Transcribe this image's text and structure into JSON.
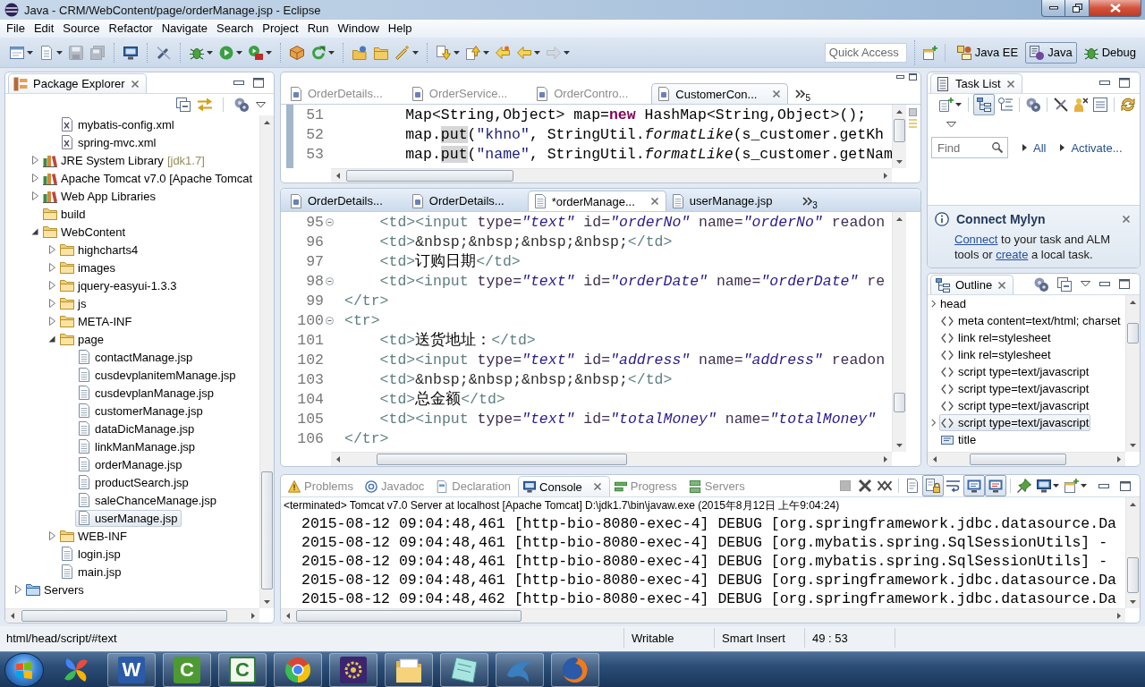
{
  "window": {
    "title": "Java - CRM/WebContent/page/orderManage.jsp - Eclipse"
  },
  "menu": [
    "File",
    "Edit",
    "Source",
    "Refactor",
    "Navigate",
    "Search",
    "Project",
    "Run",
    "Window",
    "Help"
  ],
  "toolbar": {
    "groups": [
      [
        {
          "kind": "new-window",
          "dropdown": true,
          "disabled": false
        },
        {
          "kind": "new",
          "dropdown": true,
          "disabled": false
        },
        {
          "kind": "save",
          "dropdown": false,
          "disabled": true
        },
        {
          "kind": "save-all",
          "dropdown": false,
          "disabled": true
        }
      ],
      [
        {
          "kind": "monitor",
          "dropdown": false,
          "disabled": false
        }
      ],
      [
        {
          "kind": "pen",
          "dropdown": false,
          "disabled": false
        }
      ],
      [
        {
          "kind": "bug",
          "dropdown": true,
          "disabled": false
        },
        {
          "kind": "run",
          "dropdown": true,
          "disabled": false
        },
        {
          "kind": "external",
          "dropdown": true,
          "disabled": false
        }
      ],
      [
        {
          "kind": "package",
          "dropdown": false,
          "disabled": false
        },
        {
          "kind": "refresh",
          "dropdown": true,
          "disabled": false
        }
      ],
      [
        {
          "kind": "open-type",
          "dropdown": false,
          "disabled": false
        },
        {
          "kind": "folder",
          "dropdown": false,
          "disabled": false
        },
        {
          "kind": "wand",
          "dropdown": true,
          "disabled": false
        }
      ],
      [
        {
          "kind": "arrow-down",
          "dropdown": true,
          "disabled": false
        },
        {
          "kind": "arrow-up",
          "dropdown": true,
          "disabled": false
        },
        {
          "kind": "edit-back",
          "dropdown": false,
          "disabled": false
        },
        {
          "kind": "back",
          "dropdown": true,
          "disabled": false
        },
        {
          "kind": "forward",
          "dropdown": true,
          "disabled": true
        }
      ]
    ],
    "quick_access": {
      "placeholder": "Quick Access"
    },
    "perspectives": [
      {
        "label": "Java EE",
        "kind": "java-ee",
        "selected": false
      },
      {
        "label": "Java",
        "kind": "java",
        "selected": true
      },
      {
        "label": "Debug",
        "kind": "debug",
        "selected": false
      }
    ]
  },
  "package_explorer": {
    "title": "Package Explorer",
    "tree": [
      {
        "children": [
          {
            "children": [
              {
                "label": "mybatis-config.xml",
                "kind": "xml",
                "selected": false
              },
              {
                "label": "spring-mvc.xml",
                "kind": "xml",
                "selected": false
              }
            ]
          },
          {
            "label": "JRE System Library",
            "decoration": "[jdk1.7]",
            "kind": "library",
            "expanded": false,
            "selected": false
          },
          {
            "label": "Apache Tomcat v7.0 [Apache Tomcat",
            "kind": "library",
            "expanded": false,
            "selected": false
          },
          {
            "label": "Web App Libraries",
            "kind": "library",
            "expanded": false,
            "selected": false
          },
          {
            "label": "build",
            "kind": "folder",
            "selected": false
          },
          {
            "label": "WebContent",
            "kind": "folder",
            "expanded": true,
            "selected": false,
            "children": [
              {
                "label": "highcharts4",
                "kind": "folder",
                "expanded": false,
                "selected": false
              },
              {
                "label": "images",
                "kind": "folder",
                "expanded": false,
                "selected": false
              },
              {
                "label": "jquery-easyui-1.3.3",
                "kind": "folder",
                "expanded": false,
                "selected": false
              },
              {
                "label": "js",
                "kind": "folder",
                "expanded": false,
                "selected": false
              },
              {
                "label": "META-INF",
                "kind": "folder",
                "expanded": false,
                "selected": false
              },
              {
                "label": "page",
                "kind": "folder",
                "expanded": true,
                "selected": false,
                "children": [
                  {
                    "label": "contactManage.jsp",
                    "kind": "jsp",
                    "selected": false
                  },
                  {
                    "label": "cusdevplanitemManage.jsp",
                    "kind": "jsp",
                    "selected": false
                  },
                  {
                    "label": "cusdevplanManage.jsp",
                    "kind": "jsp",
                    "selected": false
                  },
                  {
                    "label": "customerManage.jsp",
                    "kind": "jsp",
                    "selected": false
                  },
                  {
                    "label": "dataDicManage.jsp",
                    "kind": "jsp",
                    "selected": false
                  },
                  {
                    "label": "linkManManage.jsp",
                    "kind": "jsp",
                    "selected": false
                  },
                  {
                    "label": "orderManage.jsp",
                    "kind": "jsp",
                    "selected": false
                  },
                  {
                    "label": "productSearch.jsp",
                    "kind": "jsp",
                    "selected": false
                  },
                  {
                    "label": "saleChanceManage.jsp",
                    "kind": "jsp",
                    "selected": false
                  },
                  {
                    "label": "userManage.jsp",
                    "kind": "jsp",
                    "selected": true
                  }
                ]
              },
              {
                "label": "WEB-INF",
                "kind": "folder",
                "expanded": false,
                "selected": false
              },
              {
                "label": "login.jsp",
                "kind": "jsp",
                "selected": false
              },
              {
                "label": "main.jsp",
                "kind": "jsp",
                "selected": false
              }
            ]
          }
        ]
      },
      {
        "label": "Servers",
        "kind": "server-folder",
        "expanded": false,
        "selected": false
      }
    ]
  },
  "editors": [
    {
      "active": false,
      "highlight_range": true,
      "overflow": "5",
      "tabs": [
        {
          "label": "OrderDetails...",
          "kind": "java",
          "selected": false
        },
        {
          "label": "OrderService...",
          "kind": "java",
          "selected": false
        },
        {
          "label": "OrderContro...",
          "kind": "java",
          "selected": false
        },
        {
          "label": "CustomerCon...",
          "kind": "java",
          "selected": true
        }
      ],
      "lines": [
        {
          "number": "51",
          "foldable": false,
          "tokens": [
            {
              "text": "        Map<String,Object> map=",
              "kind": "plain"
            },
            {
              "text": "new",
              "kind": "keyword"
            },
            {
              "text": " HashMap<String,Object>();",
              "kind": "plain"
            }
          ]
        },
        {
          "number": "52",
          "foldable": false,
          "tokens": [
            {
              "text": "        map.",
              "kind": "plain"
            },
            {
              "text": "put",
              "kind": "occurrence"
            },
            {
              "text": "(",
              "kind": "plain"
            },
            {
              "text": "\"khno\"",
              "kind": "string"
            },
            {
              "text": ", StringUtil.",
              "kind": "plain"
            },
            {
              "text": "formatLike",
              "kind": "static"
            },
            {
              "text": "(s_customer.getKh",
              "kind": "plain"
            }
          ]
        },
        {
          "number": "53",
          "foldable": false,
          "tokens": [
            {
              "text": "        map.",
              "kind": "plain"
            },
            {
              "text": "put",
              "kind": "occurrence"
            },
            {
              "text": "(",
              "kind": "plain"
            },
            {
              "text": "\"name\"",
              "kind": "string"
            },
            {
              "text": ", StringUtil.",
              "kind": "plain"
            },
            {
              "text": "formatLike",
              "kind": "static"
            },
            {
              "text": "(s_customer.getNam",
              "kind": "plain"
            }
          ]
        }
      ]
    },
    {
      "active": true,
      "highlight_range": false,
      "overflow": "3",
      "tabs": [
        {
          "label": "OrderDetails...",
          "kind": "java",
          "selected": false
        },
        {
          "label": "OrderDetails...",
          "kind": "java",
          "selected": false
        },
        {
          "label": "*orderManage...",
          "kind": "jsp",
          "selected": true
        },
        {
          "label": "userManage.jsp",
          "kind": "jsp",
          "selected": false
        }
      ],
      "lines": [
        {
          "number": "95",
          "foldable": true,
          "tokens": [
            {
              "text": "    <td><input",
              "kind": "tag"
            },
            {
              "text": " type=",
              "kind": "attr"
            },
            {
              "text": "\"text\"",
              "kind": "value"
            },
            {
              "text": " id=",
              "kind": "attr"
            },
            {
              "text": "\"orderNo\"",
              "kind": "value"
            },
            {
              "text": " name=",
              "kind": "attr"
            },
            {
              "text": "\"orderNo\"",
              "kind": "value"
            },
            {
              "text": " readon",
              "kind": "attr"
            }
          ]
        },
        {
          "number": "96",
          "foldable": false,
          "tokens": [
            {
              "text": "    <td>",
              "kind": "tag"
            },
            {
              "text": "&nbsp;&nbsp;&nbsp;&nbsp;",
              "kind": "entity"
            },
            {
              "text": "</td>",
              "kind": "tag"
            }
          ]
        },
        {
          "number": "97",
          "foldable": false,
          "tokens": [
            {
              "text": "    <td>",
              "kind": "tag"
            },
            {
              "text": "订购日期",
              "kind": "text"
            },
            {
              "text": "</td>",
              "kind": "tag"
            }
          ]
        },
        {
          "number": "98",
          "foldable": true,
          "tokens": [
            {
              "text": "    <td><input",
              "kind": "tag"
            },
            {
              "text": " type=",
              "kind": "attr"
            },
            {
              "text": "\"text\"",
              "kind": "value"
            },
            {
              "text": " id=",
              "kind": "attr"
            },
            {
              "text": "\"orderDate\"",
              "kind": "value"
            },
            {
              "text": " name=",
              "kind": "attr"
            },
            {
              "text": "\"orderDate\"",
              "kind": "value"
            },
            {
              "text": " re",
              "kind": "attr"
            }
          ]
        },
        {
          "number": "99",
          "foldable": false,
          "tokens": [
            {
              "text": "</tr>",
              "kind": "tag"
            }
          ]
        },
        {
          "number": "100",
          "foldable": true,
          "tokens": [
            {
              "text": "<tr>",
              "kind": "tag"
            }
          ]
        },
        {
          "number": "101",
          "foldable": false,
          "tokens": [
            {
              "text": "    <td>",
              "kind": "tag"
            },
            {
              "text": "送货地址：",
              "kind": "text"
            },
            {
              "text": "</td>",
              "kind": "tag"
            }
          ]
        },
        {
          "number": "102",
          "foldable": false,
          "tokens": [
            {
              "text": "    <td><input",
              "kind": "tag"
            },
            {
              "text": " type=",
              "kind": "attr"
            },
            {
              "text": "\"text\"",
              "kind": "value"
            },
            {
              "text": " id=",
              "kind": "attr"
            },
            {
              "text": "\"address\"",
              "kind": "value"
            },
            {
              "text": " name=",
              "kind": "attr"
            },
            {
              "text": "\"address\"",
              "kind": "value"
            },
            {
              "text": " readon",
              "kind": "attr"
            }
          ]
        },
        {
          "number": "103",
          "foldable": false,
          "tokens": [
            {
              "text": "    <td>",
              "kind": "tag"
            },
            {
              "text": "&nbsp;&nbsp;&nbsp;&nbsp;",
              "kind": "entity"
            },
            {
              "text": "</td>",
              "kind": "tag"
            }
          ]
        },
        {
          "number": "104",
          "foldable": false,
          "tokens": [
            {
              "text": "    <td>",
              "kind": "tag"
            },
            {
              "text": "总金额",
              "kind": "text"
            },
            {
              "text": "</td>",
              "kind": "tag"
            }
          ]
        },
        {
          "number": "105",
          "foldable": false,
          "tokens": [
            {
              "text": "    <td><input",
              "kind": "tag"
            },
            {
              "text": " type=",
              "kind": "attr"
            },
            {
              "text": "\"text\"",
              "kind": "value"
            },
            {
              "text": " id=",
              "kind": "attr"
            },
            {
              "text": "\"totalMoney\"",
              "kind": "value"
            },
            {
              "text": " name=",
              "kind": "attr"
            },
            {
              "text": "\"totalMoney\"",
              "kind": "value"
            }
          ]
        },
        {
          "number": "106",
          "foldable": false,
          "tokens": [
            {
              "text": "</tr>",
              "kind": "tag"
            }
          ]
        }
      ]
    }
  ],
  "task_list": {
    "title": "Task List",
    "tools": [
      [
        {
          "kind": "new-task",
          "dropdown": true,
          "pressed": false
        }
      ],
      [
        {
          "kind": "categorized",
          "dropdown": false,
          "pressed": true
        },
        {
          "kind": "scheduled",
          "dropdown": false,
          "pressed": false
        }
      ],
      [
        {
          "kind": "focus",
          "dropdown": false,
          "pressed": false
        }
      ],
      [
        {
          "kind": "hide-completed",
          "dropdown": false,
          "pressed": false
        },
        {
          "kind": "person",
          "dropdown": false,
          "pressed": false
        },
        {
          "kind": "collapse",
          "dropdown": false,
          "pressed": false
        }
      ],
      [
        {
          "kind": "sync",
          "dropdown": false,
          "pressed": false
        }
      ]
    ],
    "find": {
      "placeholder": "Find"
    },
    "filters": [
      "All",
      "Activate..."
    ]
  },
  "mylyn": {
    "title": "Connect Mylyn",
    "lines": [
      [
        {
          "text": "Connect",
          "kind": "link"
        },
        {
          "text": " to your task and ALM",
          "kind": "plain"
        }
      ],
      [
        {
          "text": "tools or ",
          "kind": "plain"
        },
        {
          "text": "create",
          "kind": "link"
        },
        {
          "text": " a local task.",
          "kind": "plain"
        }
      ]
    ]
  },
  "outline": {
    "title": "Outline",
    "tree": [
      {
        "label": "head",
        "kind": "plain",
        "expandable": true,
        "selected": false,
        "children": [
          {
            "label": "meta content=text/html; charset",
            "kind": "tag",
            "expandable": false,
            "selected": false
          },
          {
            "label": "link rel=stylesheet",
            "kind": "tag",
            "expandable": false,
            "selected": false
          },
          {
            "label": "link rel=stylesheet",
            "kind": "tag",
            "expandable": false,
            "selected": false
          },
          {
            "label": "script type=text/javascript",
            "kind": "tag",
            "expandable": false,
            "selected": false
          },
          {
            "label": "script type=text/javascript",
            "kind": "tag",
            "expandable": false,
            "selected": false
          },
          {
            "label": "script type=text/javascript",
            "kind": "tag",
            "expandable": false,
            "selected": false
          },
          {
            "label": "script type=text/javascript",
            "kind": "tag",
            "expandable": true,
            "selected": true
          },
          {
            "label": "title",
            "kind": "title",
            "expandable": false,
            "selected": false
          }
        ]
      }
    ]
  },
  "console": {
    "tabs": [
      {
        "label": "Problems",
        "kind": "problems",
        "selected": false
      },
      {
        "label": "Javadoc",
        "kind": "javadoc",
        "selected": false
      },
      {
        "label": "Declaration",
        "kind": "declaration",
        "selected": false
      },
      {
        "label": "Console",
        "kind": "console",
        "selected": true
      },
      {
        "label": "Progress",
        "kind": "progress",
        "selected": false
      },
      {
        "label": "Servers",
        "kind": "servers",
        "selected": false
      }
    ],
    "tools": [
      [
        {
          "kind": "terminate",
          "dropdown": false,
          "pressed": false,
          "disabled": true
        },
        {
          "kind": "remove-launch",
          "dropdown": false,
          "pressed": false,
          "disabled": false
        },
        {
          "kind": "remove-all",
          "dropdown": false,
          "pressed": false,
          "disabled": false
        }
      ],
      [
        {
          "kind": "clear",
          "dropdown": false,
          "pressed": false,
          "disabled": false
        },
        {
          "kind": "scroll-lock",
          "dropdown": false,
          "pressed": true,
          "disabled": false
        },
        {
          "kind": "word-wrap",
          "dropdown": false,
          "pressed": false,
          "disabled": false
        },
        {
          "kind": "show-stdout",
          "dropdown": false,
          "pressed": true,
          "disabled": false
        },
        {
          "kind": "show-stderr",
          "dropdown": false,
          "pressed": true,
          "disabled": false
        }
      ],
      [
        {
          "kind": "pin",
          "dropdown": false,
          "pressed": false,
          "disabled": false
        },
        {
          "kind": "display",
          "dropdown": true,
          "pressed": false,
          "disabled": false
        },
        {
          "kind": "open-console",
          "dropdown": true,
          "pressed": false,
          "disabled": false
        }
      ]
    ],
    "process": "<terminated> Tomcat v7.0 Server at localhost [Apache Tomcat] D:\\jdk1.7\\bin\\javaw.exe (2015年8月12日 上午9:04:24)",
    "lines": [
      "2015-08-12 09:04:48,461 [http-bio-8080-exec-4] DEBUG [org.springframework.jdbc.datasource.Da",
      "2015-08-12 09:04:48,461 [http-bio-8080-exec-4] DEBUG [org.mybatis.spring.SqlSessionUtils] -",
      "2015-08-12 09:04:48,461 [http-bio-8080-exec-4] DEBUG [org.mybatis.spring.SqlSessionUtils] -",
      "2015-08-12 09:04:48,461 [http-bio-8080-exec-4] DEBUG [org.springframework.jdbc.datasource.Da",
      "2015-08-12 09:04:48,462 [http-bio-8080-exec-4] DEBUG [org.springframework.jdbc.datasource.Da"
    ]
  },
  "status_bar": {
    "path": "html/head/script/#text",
    "write_mode": "Writable",
    "insert_mode": "Smart Insert",
    "position": "49 : 53"
  },
  "taskbar": {
    "apps": [
      {
        "kind": "pinwheel",
        "running": false
      },
      {
        "kind": "tile",
        "glyph": "W",
        "color": "#2b5ba8",
        "running": true
      },
      {
        "kind": "tile",
        "glyph": "C",
        "color": "#4e9a32",
        "running": true
      },
      {
        "kind": "outline-tile",
        "glyph": "C",
        "color": "#2e7d32",
        "running": true
      },
      {
        "kind": "tricolor",
        "running": true
      },
      {
        "kind": "gear-tile",
        "running": true
      },
      {
        "kind": "folder",
        "running": true
      },
      {
        "kind": "notebook",
        "running": true
      },
      {
        "kind": "dolphin",
        "running": true
      },
      {
        "kind": "globe",
        "running": true
      }
    ]
  }
}
